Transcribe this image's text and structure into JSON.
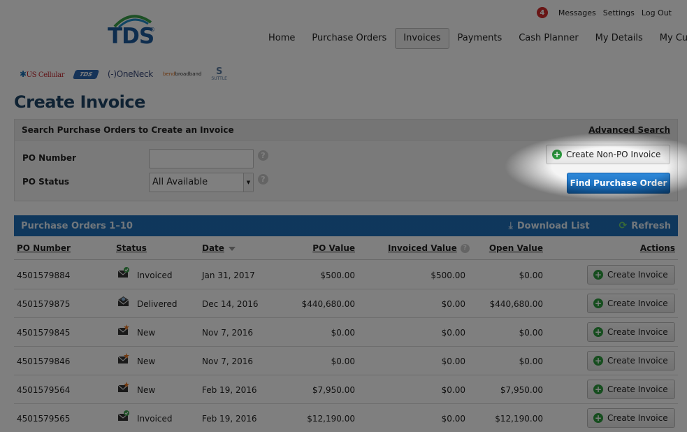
{
  "header": {
    "logo_text": "TDS",
    "logo_reg": "®",
    "utility": {
      "message_count": "4",
      "messages": "Messages",
      "settings": "Settings",
      "logout": "Log Out"
    },
    "nav": [
      "Home",
      "Purchase Orders",
      "Invoices",
      "Payments",
      "Cash Planner",
      "My Details",
      "My Customer"
    ],
    "active_nav": "Invoices",
    "partners": {
      "uscellular": "US Cellular",
      "tds": "TDS",
      "oneneck": "OneNeck",
      "bend_prefix": "bend",
      "bend_suffix": "broadband",
      "suttle_mark": "S",
      "suttle": "SUTTLE"
    }
  },
  "page": {
    "title": "Create Invoice"
  },
  "search": {
    "title": "Search Purchase Orders to Create an Invoice",
    "advanced_link": "Advanced Search",
    "po_number_label": "PO Number",
    "po_number_value": "",
    "po_status_label": "PO Status",
    "po_status_value": "All Available",
    "create_non_po": "Create Non-PO Invoice",
    "find_po": "Find Purchase Order",
    "help": "?"
  },
  "table": {
    "bar_title": "Purchase Orders 1–10",
    "download": "Download List",
    "refresh": "Refresh",
    "columns": {
      "po_number": "PO Number",
      "status": "Status",
      "date": "Date",
      "po_value": "PO Value",
      "invoiced_value": "Invoiced Value",
      "open_value": "Open Value",
      "actions": "Actions"
    },
    "action_label": "Create Invoice",
    "rows": [
      {
        "po": "4501579884",
        "status": "Invoiced",
        "status_icon": "invoiced-icon",
        "date": "Jan 31, 2017",
        "po_value": "$500.00",
        "invoiced": "$500.00",
        "open": "$0.00"
      },
      {
        "po": "4501579875",
        "status": "Delivered",
        "status_icon": "delivered-icon",
        "date": "Dec 14, 2016",
        "po_value": "$440,680.00",
        "invoiced": "$0.00",
        "open": "$440,680.00"
      },
      {
        "po": "4501579845",
        "status": "New",
        "status_icon": "new-icon",
        "date": "Nov 7, 2016",
        "po_value": "$0.00",
        "invoiced": "$0.00",
        "open": "$0.00"
      },
      {
        "po": "4501579846",
        "status": "New",
        "status_icon": "new-icon",
        "date": "Nov 7, 2016",
        "po_value": "$0.00",
        "invoiced": "$0.00",
        "open": "$0.00"
      },
      {
        "po": "4501579564",
        "status": "New",
        "status_icon": "new-icon",
        "date": "Feb 19, 2016",
        "po_value": "$7,950.00",
        "invoiced": "$0.00",
        "open": "$7,950.00"
      },
      {
        "po": "4501579565",
        "status": "Invoiced",
        "status_icon": "invoiced-icon",
        "date": "Feb 19, 2016",
        "po_value": "$12,190.00",
        "invoiced": "$0.00",
        "open": "$12,190.00"
      }
    ]
  },
  "colors": {
    "accent_blue": "#1e6fb8",
    "title_blue": "#1e4466",
    "success_green": "#2b9a3d",
    "alert_red": "#d22b2b"
  }
}
